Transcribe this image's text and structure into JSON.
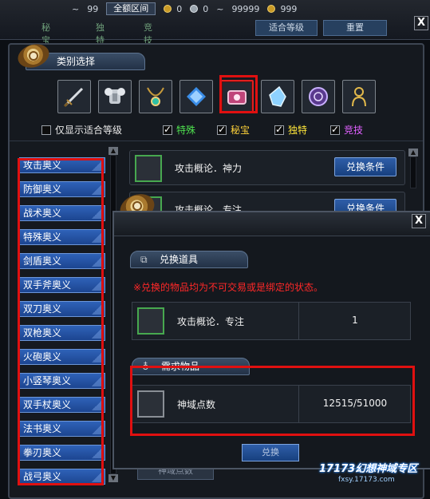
{
  "top_bar": {
    "tilde1": "~",
    "min_value": "99",
    "all_range_button": "全额区间",
    "zero1": "0",
    "zero2": "0",
    "tilde2": "~",
    "max_value": "99999",
    "gold_value": "999",
    "row2_items": [
      "秘宝",
      "独特",
      "竞技"
    ],
    "fit_level_button": "适合等级",
    "reset_button": "重置"
  },
  "category": {
    "title": "类别选择",
    "icons": [
      {
        "name": "weapon-icon",
        "selected": false
      },
      {
        "name": "armor-icon",
        "selected": false
      },
      {
        "name": "necklace-icon",
        "selected": false
      },
      {
        "name": "gem-icon",
        "selected": false
      },
      {
        "name": "treasure-box-icon",
        "selected": true
      },
      {
        "name": "crystal-icon",
        "selected": false
      },
      {
        "name": "orb-icon",
        "selected": false
      },
      {
        "name": "avatar-icon",
        "selected": false
      }
    ]
  },
  "filters": {
    "only_fit": "仅显示适合等级",
    "special": "特殊",
    "secret": "秘宝",
    "unique": "独特",
    "arena": "竞技",
    "colors": {
      "special": "#4fe24f",
      "secret": "#ffd23a",
      "unique": "#ffe63a",
      "arena": "#e060ff"
    }
  },
  "left_list": [
    "攻击奥义",
    "防御奥义",
    "战术奥义",
    "特殊奥义",
    "剑盾奥义",
    "双手斧奥义",
    "双刀奥义",
    "双枪奥义",
    "火砲奥义",
    "小竖琴奥义",
    "双手杖奥义",
    "法书奥义",
    "拳刃奥义",
    "战弓奥义"
  ],
  "right_list": [
    {
      "name": "攻击概论．神力",
      "button": "兑换条件"
    },
    {
      "name": "攻击概论．专注",
      "button": "兑换条件"
    }
  ],
  "bottom_button": "神域点数",
  "popup": {
    "section1_title": "兑换道具",
    "warning": "※兑换的物品均为不可交易或是绑定的状态。",
    "item": {
      "name": "攻击概论．专注",
      "qty": "1"
    },
    "section2_title": "需求物品",
    "required": {
      "name": "神域点数",
      "qty": "12515/51000"
    },
    "confirm": "兑换"
  },
  "close_label": "X",
  "logo": {
    "text": "17173幻想神域专区",
    "url": "fxsy.17173.com"
  }
}
